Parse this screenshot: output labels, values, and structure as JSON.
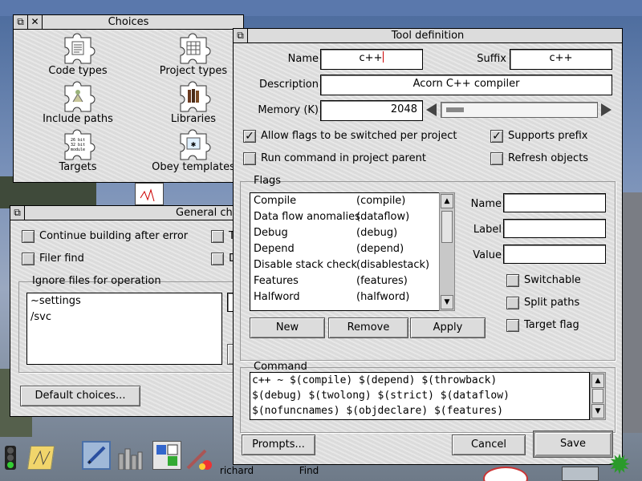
{
  "choices_window": {
    "title": "Choices",
    "icons": [
      {
        "name": "code-types",
        "label": "Code types",
        "glyph": "file-list-icon"
      },
      {
        "name": "project-types",
        "label": "Project types",
        "glyph": "grid-icon"
      },
      {
        "name": "include-paths",
        "label": "Include paths",
        "glyph": "tree-icon"
      },
      {
        "name": "libraries",
        "label": "Libraries",
        "glyph": "books-icon"
      },
      {
        "name": "targets",
        "label": "Targets",
        "glyph": "module-icon"
      },
      {
        "name": "obey-templates",
        "label": "Obey templates",
        "glyph": "obey-icon"
      }
    ],
    "targets_icon_text": [
      "26 bit",
      "32 bit",
      "module"
    ]
  },
  "general_window": {
    "title": "General cho",
    "options": [
      {
        "label": "Continue building after error",
        "checked": false
      },
      {
        "label": "Filer find",
        "checked": false
      }
    ],
    "right_partial": [
      "T",
      "D"
    ],
    "ignore_group_title": "Ignore files for operation",
    "ignore_files": [
      "~settings",
      "/svc"
    ],
    "default_button": "Default choices..."
  },
  "tool_window": {
    "title": "Tool definition",
    "name_label": "Name",
    "name_value": "c++",
    "suffix_label": "Suffix",
    "suffix_value": "c++",
    "description_label": "Description",
    "description_value": "Acorn C++ compiler",
    "memory_label": "Memory (K)",
    "memory_value": "2048",
    "memory_fraction": 0.12,
    "options": [
      {
        "label": "Allow flags to be switched per project",
        "checked": true
      },
      {
        "label": "Supports prefix",
        "checked": true
      },
      {
        "label": "Run command in project parent",
        "checked": false
      },
      {
        "label": "Refresh objects",
        "checked": false
      }
    ],
    "flags_group_title": "Flags",
    "flags": [
      {
        "name": "Compile",
        "key": "(compile)"
      },
      {
        "name": "Data flow anomalies",
        "key": "(dataflow)"
      },
      {
        "name": "Debug",
        "key": "(debug)"
      },
      {
        "name": "Depend",
        "key": "(depend)"
      },
      {
        "name": "Disable stack check",
        "key": "(disablestack)"
      },
      {
        "name": "Features",
        "key": "(features)"
      },
      {
        "name": "Halfword",
        "key": "(halfword)"
      }
    ],
    "flag_fields": {
      "name_label": "Name",
      "label_label": "Label",
      "value_label": "Value"
    },
    "flag_options": [
      {
        "label": "Switchable",
        "checked": false
      },
      {
        "label": "Split paths",
        "checked": false
      },
      {
        "label": "Target flag",
        "checked": false
      }
    ],
    "buttons": {
      "new": "New",
      "remove": "Remove",
      "apply": "Apply",
      "prompts": "Prompts...",
      "cancel": "Cancel",
      "save": "Save"
    },
    "command_group_title": "Command",
    "command_lines": [
      "c++ ~ $(compile) $(depend) $(throwback)",
      "$(debug) $(twolong) $(strict) $(dataflow)",
      "$(nofuncnames) $(objdeclare) $(features)"
    ]
  },
  "iconbar": {
    "labels": {
      "richard": "richard",
      "find": "Find"
    },
    "icons": [
      "traffic-light-icon",
      "notepad-icon",
      "pen-icon",
      "chart-icon",
      "paint-icon",
      "puzzle-small-icon",
      "clock-icon",
      "monitor-icon",
      "gear-icon"
    ]
  }
}
